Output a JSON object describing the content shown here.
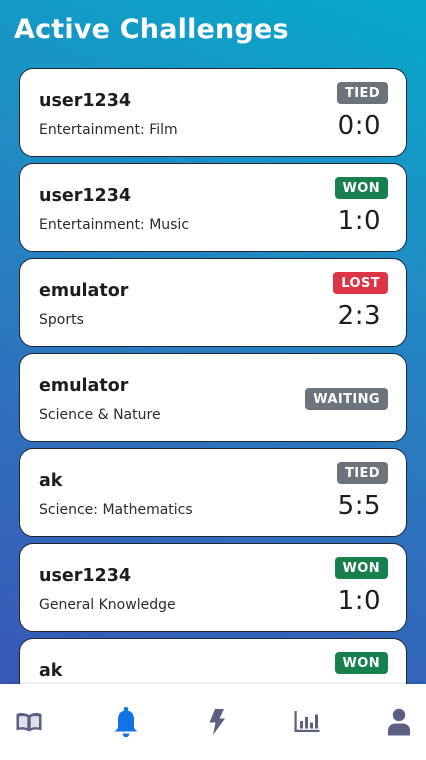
{
  "header": {
    "title": "Active Challenges"
  },
  "colors": {
    "won": "#18804f",
    "lost": "#dc3545",
    "tied": "#6b737b",
    "waiting": "#6b737b",
    "nav_active": "#1273e6",
    "nav_inactive": "#5b6080"
  },
  "challenges": [
    {
      "user": "user1234",
      "category": "Entertainment: Film",
      "status": "TIED",
      "score": "0:0"
    },
    {
      "user": "user1234",
      "category": "Entertainment: Music",
      "status": "WON",
      "score": "1:0"
    },
    {
      "user": "emulator",
      "category": "Sports",
      "status": "LOST",
      "score": "2:3"
    },
    {
      "user": "emulator",
      "category": "Science & Nature",
      "status": "WAITING",
      "score": ""
    },
    {
      "user": "ak",
      "category": "Science: Mathematics",
      "status": "TIED",
      "score": "5:5"
    },
    {
      "user": "user1234",
      "category": "General Knowledge",
      "status": "WON",
      "score": "1:0"
    },
    {
      "user": "ak",
      "category": "",
      "status": "WON",
      "score": ""
    }
  ],
  "nav": [
    {
      "icon": "book-icon",
      "active": false
    },
    {
      "icon": "bell-icon",
      "active": true
    },
    {
      "icon": "lightning-icon",
      "active": false
    },
    {
      "icon": "bar-chart-icon",
      "active": false
    },
    {
      "icon": "user-icon",
      "active": false
    }
  ]
}
